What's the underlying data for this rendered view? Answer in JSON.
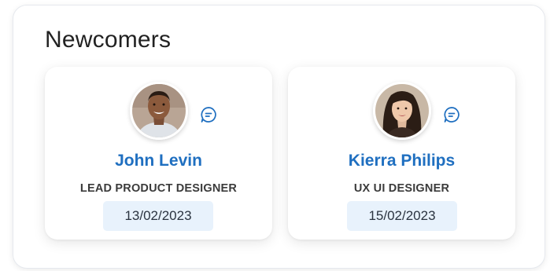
{
  "panel": {
    "title": "Newcomers"
  },
  "people": [
    {
      "name": "John Levin",
      "role": "LEAD PRODUCT DESIGNER",
      "date": "13/02/2023"
    },
    {
      "name": "Kierra Philips",
      "role": "UX UI DESIGNER",
      "date": "15/02/2023"
    }
  ],
  "colors": {
    "accent": "#1f6fc0",
    "date_bg": "#e8f2fc"
  },
  "icons": {
    "chat": "chat-bubble-icon"
  }
}
